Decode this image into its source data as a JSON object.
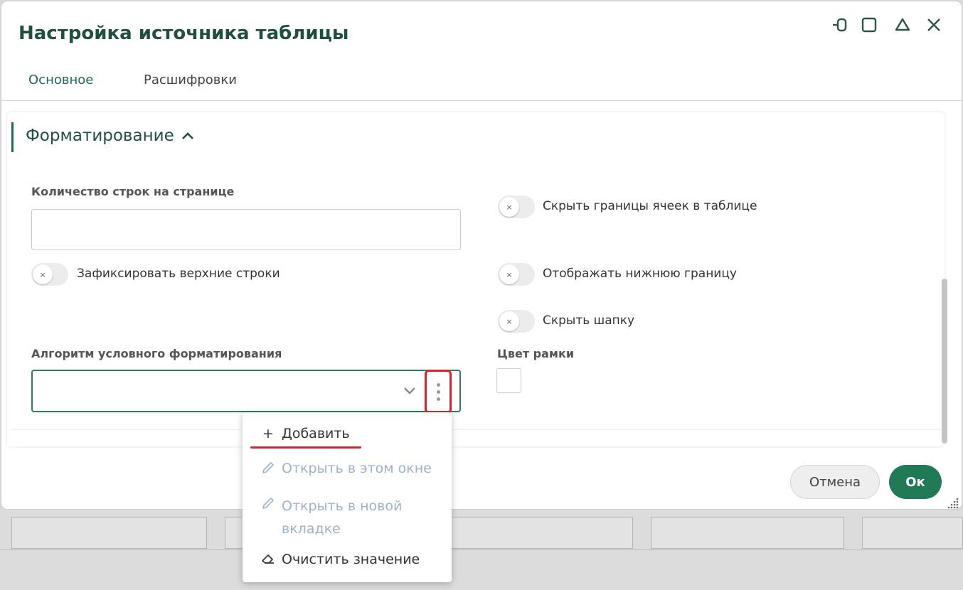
{
  "dialog": {
    "title": "Настройка источника таблицы",
    "tabs": [
      "Основное",
      "Расшифровки"
    ],
    "section_title": "Форматирование",
    "fields": {
      "rows_per_page_label": "Количество строк на странице",
      "rows_per_page_value": "",
      "cond_format_label": "Алгоритм условного форматирования",
      "cond_format_value": "",
      "border_color_label": "Цвет рамки"
    },
    "toggles": {
      "freeze_top_rows": "Зафиксировать верхние строки",
      "hide_cell_borders": "Скрыть границы ячеек в таблице",
      "show_bottom_border": "Отображать нижнюю границу",
      "hide_header": "Скрыть шапку"
    },
    "toggle_off_glyph": "×",
    "buttons": {
      "cancel": "Отмена",
      "ok": "Ок"
    }
  },
  "context_menu": {
    "items": [
      {
        "label": "Добавить",
        "icon": "plus-icon",
        "enabled": true
      },
      {
        "label": "Открыть в этом окне",
        "icon": "pencil-icon",
        "enabled": false
      },
      {
        "label": "Открыть в новой вкладке",
        "icon": "pencil-icon",
        "enabled": false
      },
      {
        "label": "Очистить значение",
        "icon": "eraser-icon",
        "enabled": true
      }
    ],
    "add_glyph": "+"
  },
  "colors": {
    "accent": "#1f6b50",
    "title": "#1f4f3f",
    "ok_button": "#1f7a55",
    "highlight": "#e0202e",
    "disabled_text": "#9eb2c8"
  }
}
